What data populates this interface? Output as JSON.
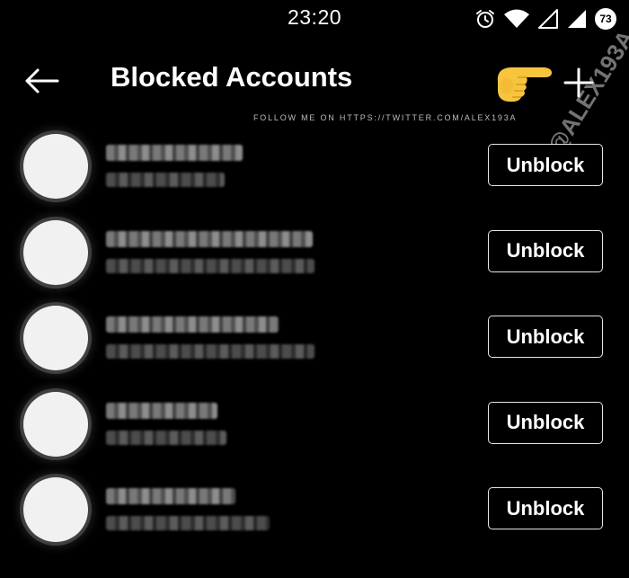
{
  "status_bar": {
    "time": "23:20",
    "battery_level": "73",
    "icons": [
      "alarm-icon",
      "wifi-icon",
      "signal-outline-icon",
      "signal-icon",
      "battery-icon"
    ]
  },
  "header": {
    "title": "Blocked Accounts",
    "back_icon": "arrow-left-icon",
    "add_icon": "plus-icon",
    "emoji": "backhand-index-pointing-right"
  },
  "watermark": {
    "follow_text": "FOLLOW ME ON HTTPS://TWITTER.COM/ALEX193A",
    "handle": "@ALEX193A"
  },
  "accounts": [
    {
      "unblock_label": "Unblock",
      "username_blurred": true,
      "fullname_blurred": true
    },
    {
      "unblock_label": "Unblock",
      "username_blurred": true,
      "fullname_blurred": true
    },
    {
      "unblock_label": "Unblock",
      "username_blurred": true,
      "fullname_blurred": true
    },
    {
      "unblock_label": "Unblock",
      "username_blurred": true,
      "fullname_blurred": true
    },
    {
      "unblock_label": "Unblock",
      "username_blurred": true,
      "fullname_blurred": true
    }
  ],
  "colors": {
    "background": "#000000",
    "text": "#ffffff",
    "button_border": "#e6e6e6",
    "emoji_yellow": "#f7c53d"
  }
}
